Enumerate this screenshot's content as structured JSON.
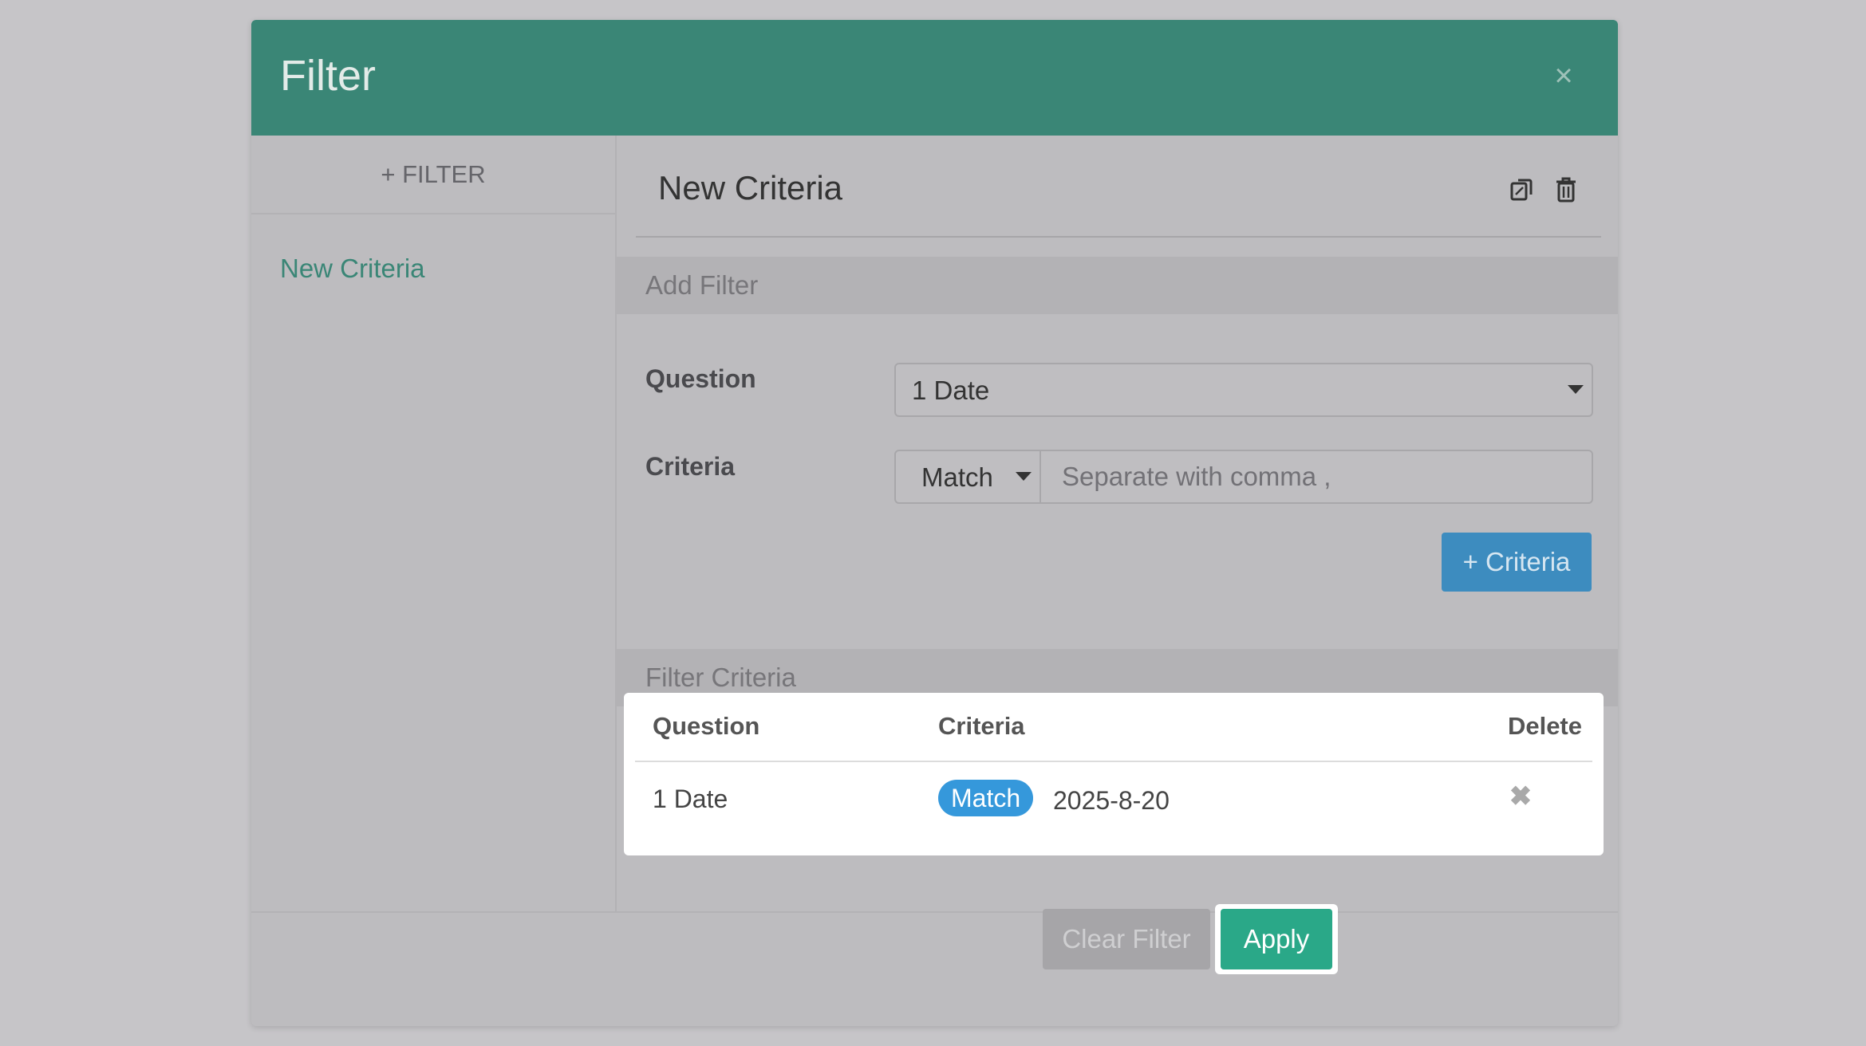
{
  "modal": {
    "title": "Filter",
    "close_icon": "close-icon"
  },
  "sidebar": {
    "add_filter_label": "+ FILTER",
    "items": [
      {
        "label": "New Criteria"
      }
    ]
  },
  "criteria": {
    "title": "New Criteria",
    "icons": [
      "copy-icon",
      "trash-icon"
    ]
  },
  "add_filter": {
    "section_label": "Add Filter",
    "question_label": "Question",
    "question_value": "1 Date",
    "criteria_label": "Criteria",
    "match_value": "Match",
    "criteria_placeholder": "Separate with comma ,",
    "add_criteria_label": "+ Criteria"
  },
  "filter_criteria": {
    "section_label": "Filter Criteria",
    "columns": [
      "Question",
      "Criteria",
      "Delete"
    ],
    "rows": [
      {
        "question": "1 Date",
        "match": "Match",
        "value": "2025-8-20",
        "delete_icon": "✖"
      }
    ]
  },
  "footer": {
    "clear_label": "Clear Filter",
    "apply_label": "Apply"
  },
  "colors": {
    "header": "#3a8676",
    "accent_link": "#3a8676",
    "apply": "#2aa888",
    "criteria_button": "#3d8cbf",
    "badge": "#3598db"
  }
}
